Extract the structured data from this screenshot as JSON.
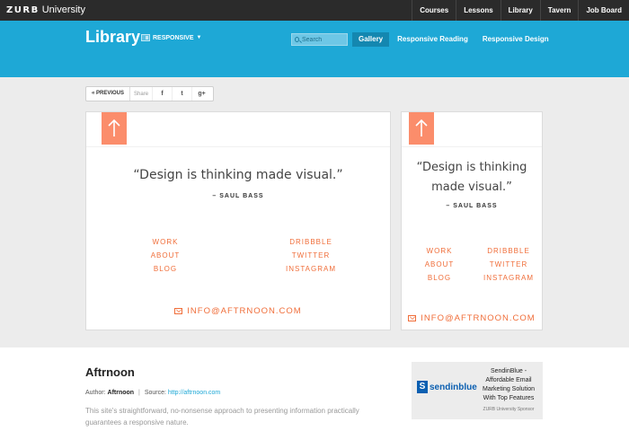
{
  "topbar": {
    "logo_mark": "ZURB",
    "logo_text": "University",
    "nav": [
      "Courses",
      "Lessons",
      "Library",
      "Tavern",
      "Job Board"
    ]
  },
  "header": {
    "title": "Library",
    "category": "RESPONSIVE",
    "search_placeholder": "Search",
    "tabs": [
      {
        "label": "Gallery",
        "active": true
      },
      {
        "label": "Responsive Reading",
        "active": false
      },
      {
        "label": "Responsive Design",
        "active": false
      }
    ]
  },
  "sharebar": {
    "previous": "« PREVIOUS",
    "share": "Share",
    "facebook": "f",
    "twitter": "t",
    "google": "g+"
  },
  "preview": {
    "quote_line1": "“Design is thinking made visual.”",
    "quote_small_line1": "“Design is thinking",
    "quote_small_line2": "made visual.”",
    "author": "– SAUL BASS",
    "links_left": [
      "WORK",
      "ABOUT",
      "BLOG"
    ],
    "links_right": [
      "DRIBBBLE",
      "TWITTER",
      "INSTAGRAM"
    ],
    "email": "INFO@AFTRNOON.COM"
  },
  "site": {
    "name": "Aftrnoon",
    "author_label": "Author:",
    "author": "Aftrnoon",
    "separator": "|",
    "source_label": "Source:",
    "source_url": "http://aftrnoon.com",
    "description": "This site's straightforward, no-nonsense approach to presenting information practically guarantees a responsive nature."
  },
  "sponsor": {
    "brand": "sendinblue",
    "brand_mark": "S",
    "text": "SendinBlue - Affordable Email Marketing Solution With Top Features",
    "footer": "ZURB University Sponsor"
  },
  "colors": {
    "brand_blue": "#1ea8d6",
    "accent_orange": "#f06e3a",
    "arrow_box": "#fb8d6b"
  }
}
